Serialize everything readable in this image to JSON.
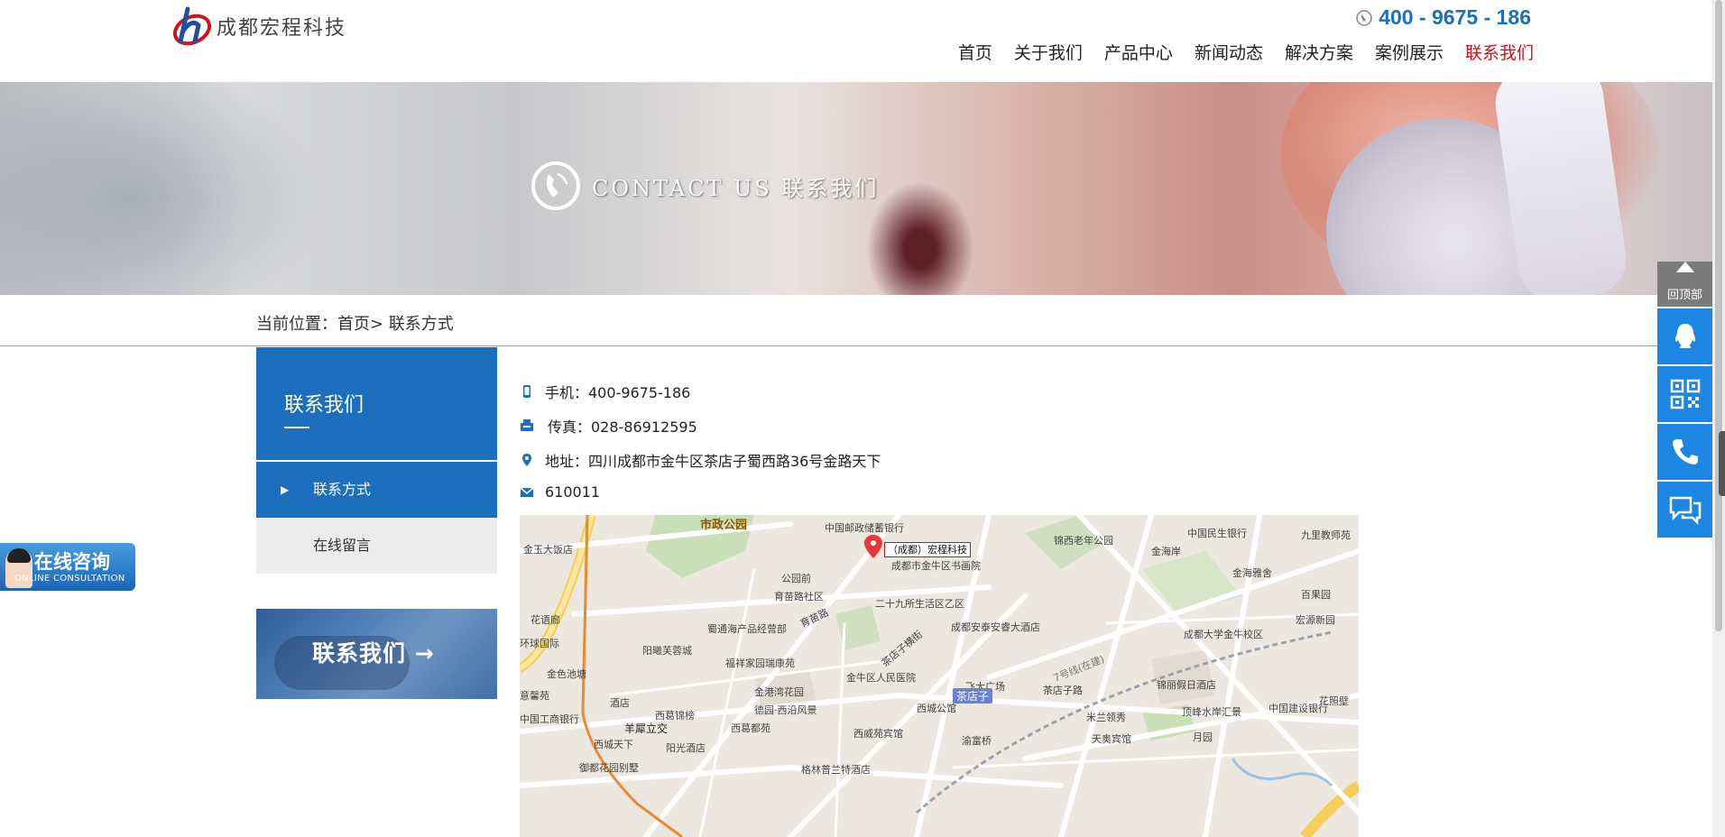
{
  "header": {
    "logo_text": "成都宏程科技",
    "hotline": "400 - 9675 - 186",
    "nav": [
      {
        "label": "首页"
      },
      {
        "label": "关于我们"
      },
      {
        "label": "产品中心"
      },
      {
        "label": "新闻动态"
      },
      {
        "label": "解决方案"
      },
      {
        "label": "案例展示"
      },
      {
        "label": "联系我们"
      }
    ],
    "accent_color": "#1c6fbd",
    "active_color": "#d0121b"
  },
  "banner": {
    "title": "CONTACT US 联系我们"
  },
  "breadcrumb": "当前位置：首页> 联系方式",
  "sidebar": {
    "title": "联系我们",
    "items": [
      {
        "label": "联系方式",
        "active": true
      },
      {
        "label": "在线留言",
        "active": false
      }
    ],
    "promo": "联系我们 →"
  },
  "contact": {
    "mobile": "手机：400-9675-186",
    "fax": "传真：028-86912595",
    "address": "地址：四川成都市金牛区茶店子蜀西路36号金路天下",
    "postcode": "610011"
  },
  "map": {
    "marker_label": "（成都）宏程科技",
    "labels": [
      "市政公园",
      "中国邮政储蓄银行",
      "成都市金牛区书画院",
      "公园前",
      "育苗路社区",
      "二十九所生活区乙区",
      "中国民生银行",
      "九里教师苑",
      "锦西老年公园",
      "金海岸",
      "金海雅舍",
      "百果园",
      "宏源新园",
      "成都大学金牛校区",
      "锦丽假日酒店",
      "花照壁",
      "金玉大饭店",
      "花语廊",
      "环球国际",
      "阳曦芙蓉城",
      "福祥家园瑞康苑",
      "金港湾花园",
      "德园·西沿风景",
      "金色池塘",
      "意馨苑",
      "中国工商银行",
      "羊犀立交",
      "西城天下",
      "阳光酒店",
      "御都花园别墅",
      "格林普兰特酒店",
      "西威苑宾馆",
      "渝富桥",
      "西城公馆",
      "飞大广场",
      "茶店子路",
      "米兰领秀",
      "天奥宾馆",
      "月园",
      "顶峰水岸汇景",
      "中国建设银行",
      "金牛区人民医院",
      "成都安泰安睿大酒店",
      "茶店子横街",
      "育苗路",
      "蜀通海产品经营部",
      "西葛锦榜",
      "西葛都苑",
      "酒店",
      "7号线(在建)"
    ],
    "metro": "茶店子"
  },
  "float_right": {
    "back_top": "回顶部",
    "buttons": [
      "qq-icon",
      "qrcode-icon",
      "phone-icon",
      "chat-icon"
    ]
  },
  "float_left": {
    "title": "在线咨询",
    "subtitle": "ONLINE CONSULTATION"
  }
}
